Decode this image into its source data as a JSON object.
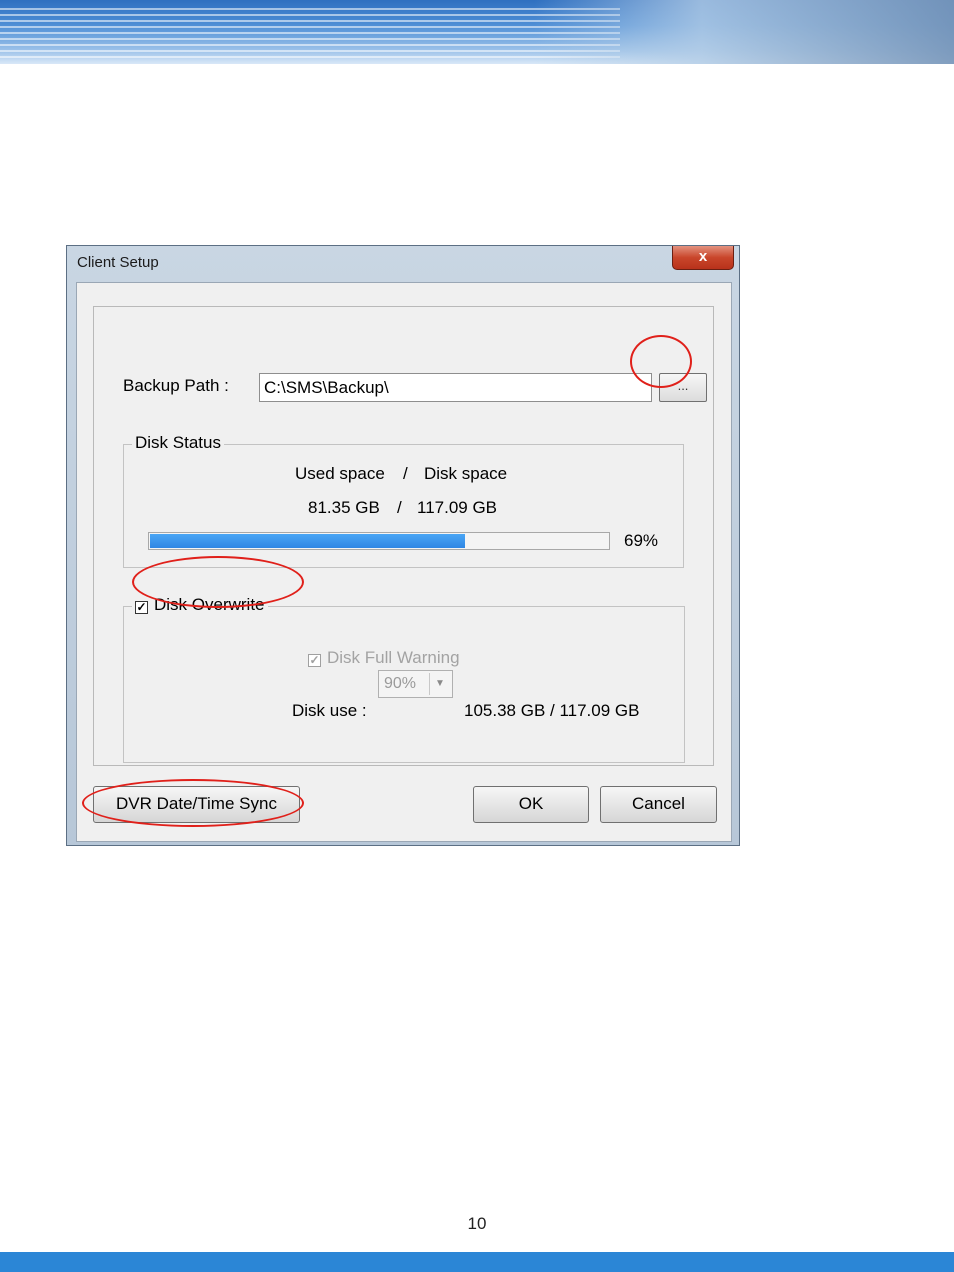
{
  "window": {
    "title": "Client Setup",
    "close_glyph": "x"
  },
  "backup": {
    "label": "Backup Path :",
    "path_value": "C:\\SMS\\Backup\\",
    "browse_label": "..."
  },
  "disk_status": {
    "legend": "Disk Status",
    "header_used": "Used space",
    "header_sep": "/",
    "header_total": "Disk space",
    "used_value": "81.35 GB",
    "value_sep": "/",
    "total_value": "117.09 GB",
    "progress_percent": 69,
    "progress_label": "69%"
  },
  "disk_overwrite": {
    "label": "Disk Overwrite",
    "checked": true,
    "full_warning_label": "Disk Full Warning",
    "full_warning_checked": true,
    "disk_use_label": "Disk use :",
    "disk_use_selected": "90%",
    "disk_use_summary": "105.38 GB / 117.09 GB"
  },
  "buttons": {
    "sync": "DVR Date/Time Sync",
    "ok": "OK",
    "cancel": "Cancel"
  },
  "page": {
    "number": "10"
  },
  "colors": {
    "annotation": "#e0201a",
    "progress": "#2f86e4",
    "bottom_bar": "#2b86d6"
  }
}
